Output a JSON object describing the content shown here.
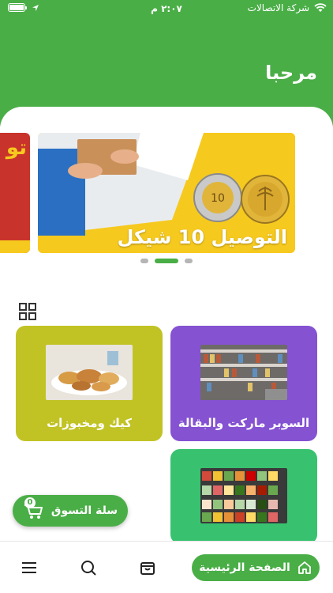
{
  "status_bar": {
    "carrier": "شركة الاتصالات",
    "time": "٢:٠٧ م",
    "battery_level": 1.0
  },
  "header": {
    "welcome": "مرحبا",
    "background_color": "#4aae47"
  },
  "banner": {
    "text": "التوصيل 10 شيكل",
    "prev_text": "تو",
    "pages": 3,
    "active_page": 2
  },
  "categories": [
    {
      "label": "السوبر ماركت والبقالة",
      "color": "#8552d2"
    },
    {
      "label": "كيك ومخبوزات",
      "color": "#c1c325"
    },
    {
      "label": "",
      "color": "#38c26f"
    }
  ],
  "cart": {
    "label": "سلة التسوق",
    "count": "0"
  },
  "bottom_nav": {
    "home_label": "الصفحة الرئيسية",
    "icons": [
      "home-icon",
      "bag-icon",
      "search-icon",
      "menu-icon"
    ]
  }
}
